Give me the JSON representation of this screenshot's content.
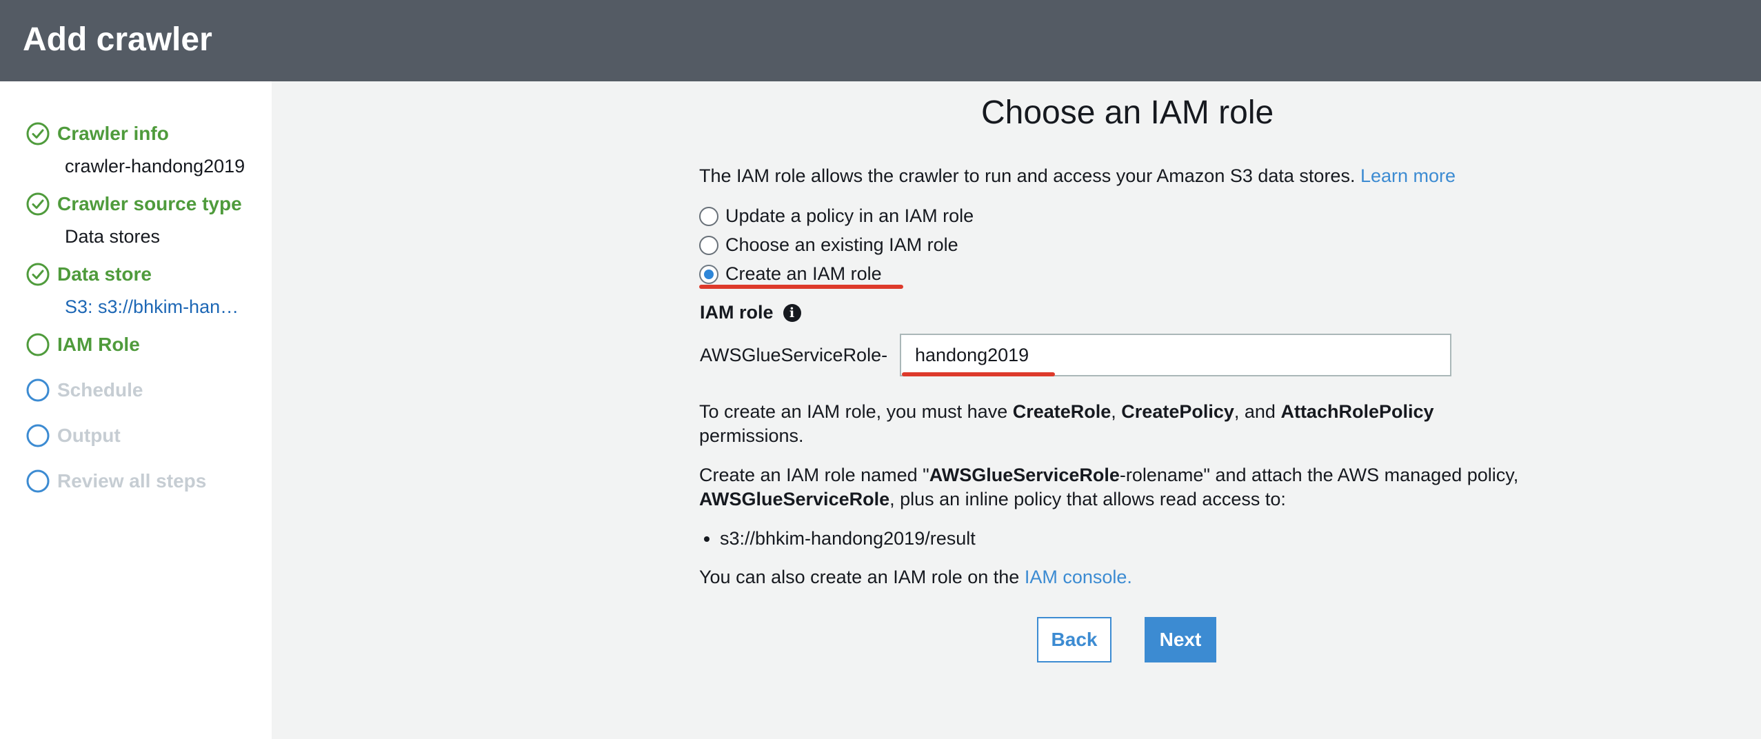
{
  "header": {
    "title": "Add crawler"
  },
  "sidebar": {
    "steps": [
      {
        "label": "Crawler info",
        "state": "done",
        "detail": "crawler-handong2019"
      },
      {
        "label": "Crawler source type",
        "state": "done",
        "detail": "Data stores"
      },
      {
        "label": "Data store",
        "state": "done",
        "detail": "S3: s3://bhkim-han…"
      },
      {
        "label": "IAM Role",
        "state": "current"
      },
      {
        "label": "Schedule",
        "state": "future"
      },
      {
        "label": "Output",
        "state": "future"
      },
      {
        "label": "Review all steps",
        "state": "future"
      }
    ]
  },
  "main": {
    "title": "Choose an IAM role",
    "intro": "The IAM role allows the crawler to run and access your Amazon S3 data stores.",
    "learn_more": "Learn more",
    "options": [
      {
        "label": "Update a policy in an IAM role",
        "checked": false
      },
      {
        "label": "Choose an existing IAM role",
        "checked": false
      },
      {
        "label": "Create an IAM role",
        "checked": true
      }
    ],
    "iam_role_label": "IAM role",
    "role_prefix": "AWSGlueServiceRole-",
    "role_name_value": "handong2019",
    "perm_text": {
      "p1": "To create an IAM role, you must have ",
      "b1": "CreateRole",
      "p2": ", ",
      "b2": "CreatePolicy",
      "p3": ", and ",
      "b3": "AttachRolePolicy",
      "p4": "permissions."
    },
    "create_text": {
      "p1": "Create an IAM role named \"",
      "b1": "AWSGlueServiceRole",
      "p2": "-rolename\" and attach the AWS managed policy,",
      "b2": "AWSGlueServiceRole",
      "p3": ", plus an inline policy that allows read access to:"
    },
    "paths": [
      "s3://bhkim-handong2019/result"
    ],
    "console_text": "You can also create an IAM role on the ",
    "console_link": "IAM console.",
    "back_label": "Back",
    "next_label": "Next"
  },
  "colors": {
    "header_bg": "#545b64",
    "step_done": "#4f9b3c",
    "step_future": "#c6cdd3",
    "link": "#3c8bd2",
    "primary_button": "#3c8bd2",
    "annotation_underline": "#dd3a2b"
  },
  "icons": {
    "step_done": "check-circle-icon",
    "step_current": "circle-icon",
    "step_future": "circle-icon",
    "info": "info-icon",
    "radio": "radio-icon"
  }
}
